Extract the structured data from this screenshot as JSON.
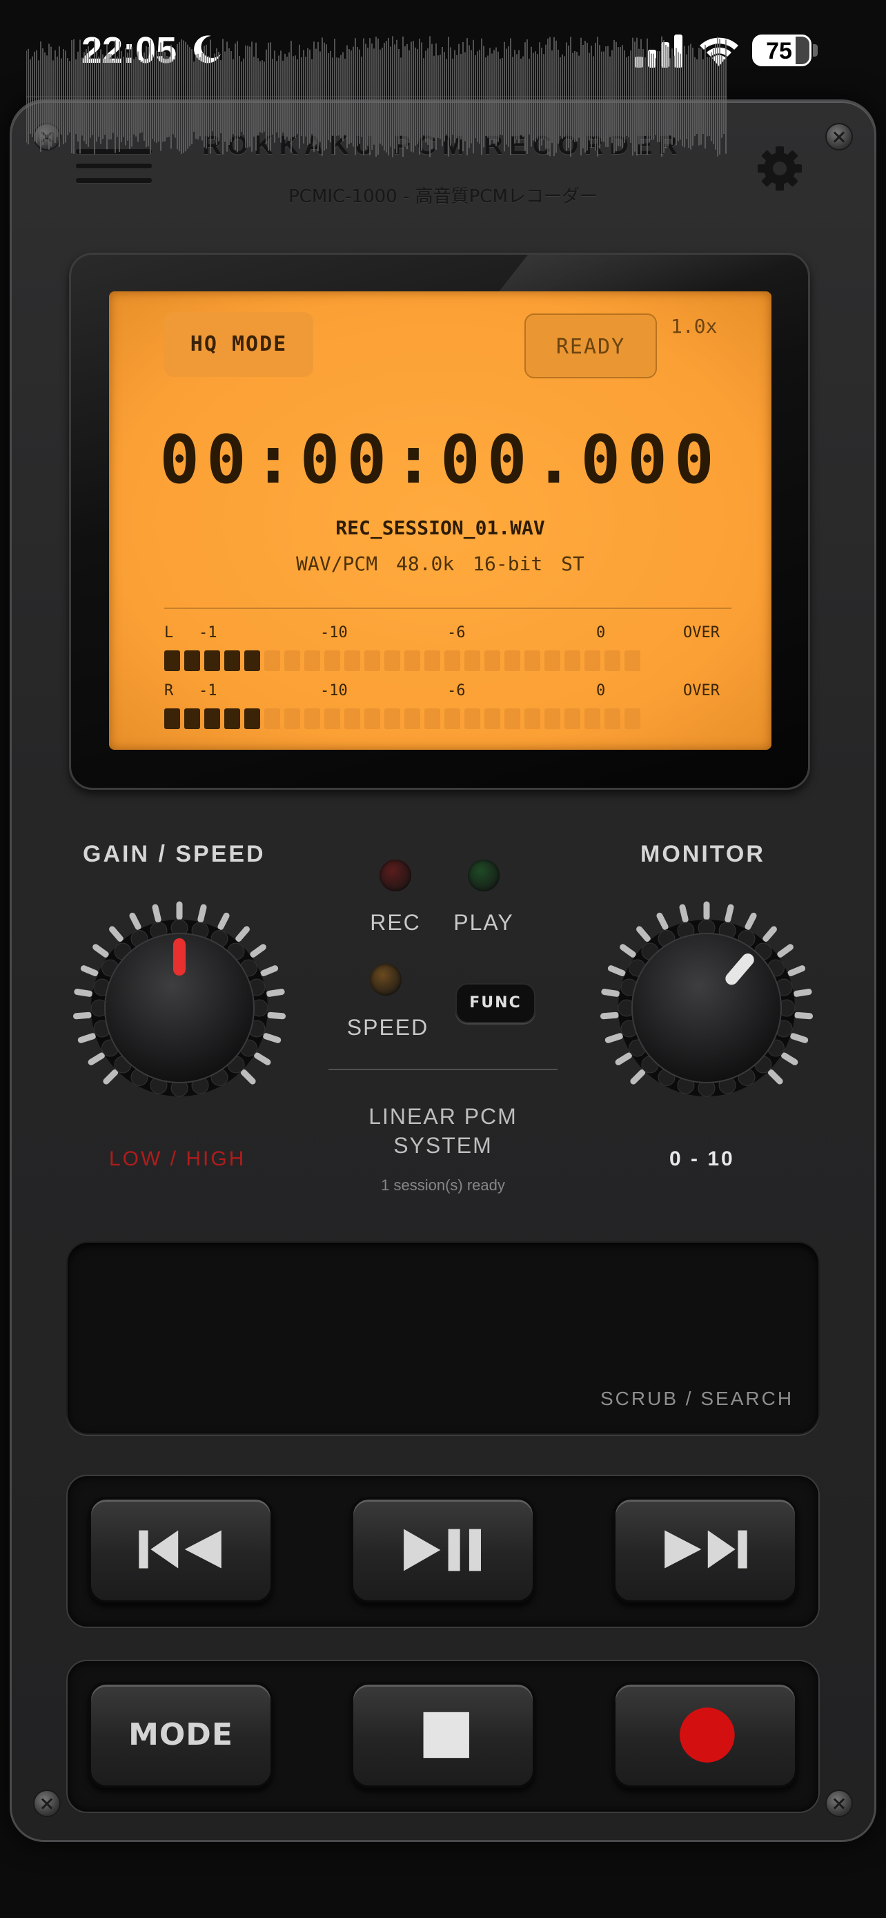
{
  "status_bar": {
    "time": "22:05",
    "battery": "75",
    "battery_level_percent": 75,
    "icons": [
      "moon-icon",
      "signal-icon",
      "wifi-icon",
      "battery-icon"
    ]
  },
  "header": {
    "title": "ROKKAKU PCM RECORDER",
    "subtitle": "PCMIC-1000 - 高音質PCMレコーダー"
  },
  "lcd": {
    "mode_chip": "HQ MODE",
    "state_chip": "READY",
    "speed": "1.0x",
    "timecode": "00:00:00.000",
    "filename": "REC_SESSION_01.WAV",
    "format": "WAV/PCM  48.0k  16-bit  ST",
    "meters": [
      {
        "channel": "L",
        "labels": [
          "-1",
          "-10",
          "-6",
          "0",
          "OVER"
        ],
        "lit_segments": 5,
        "total_segments": 24
      },
      {
        "channel": "R",
        "labels": [
          "-1",
          "-10",
          "-6",
          "0",
          "OVER"
        ],
        "lit_segments": 5,
        "total_segments": 24
      }
    ]
  },
  "controls": {
    "gain": {
      "label": "GAIN / SPEED",
      "caption": "LOW / HIGH",
      "indicator_color": "#e8302e",
      "level_fraction": 0.5
    },
    "monitor": {
      "label": "MONITOR",
      "caption": "0 - 10",
      "indicator_color": "#e6e6e6",
      "level_fraction": 0.65
    },
    "leds": {
      "rec": "REC",
      "play": "PLAY",
      "speed": "SPEED"
    },
    "led_colors": {
      "rec": "#5a1c1c",
      "play": "#1f4a26",
      "speed": "#6a4a1e"
    },
    "func": "FUNC",
    "system_title_line1": "LINEAR PCM",
    "system_title_line2": "SYSTEM",
    "system_status": "1 session(s) ready"
  },
  "waveform": {
    "label": "SCRUB / SEARCH"
  },
  "transport": {
    "row1": [
      "previous-icon",
      "play-pause-icon",
      "next-icon"
    ],
    "row2": {
      "mode_label": "MODE",
      "stop_icon": "stop-icon",
      "record_icon": "record-icon"
    }
  },
  "colors": {
    "lcd": "#fba035",
    "lcd_text": "#2a1a05",
    "record": "#d40f0f",
    "panel": "#262627"
  }
}
